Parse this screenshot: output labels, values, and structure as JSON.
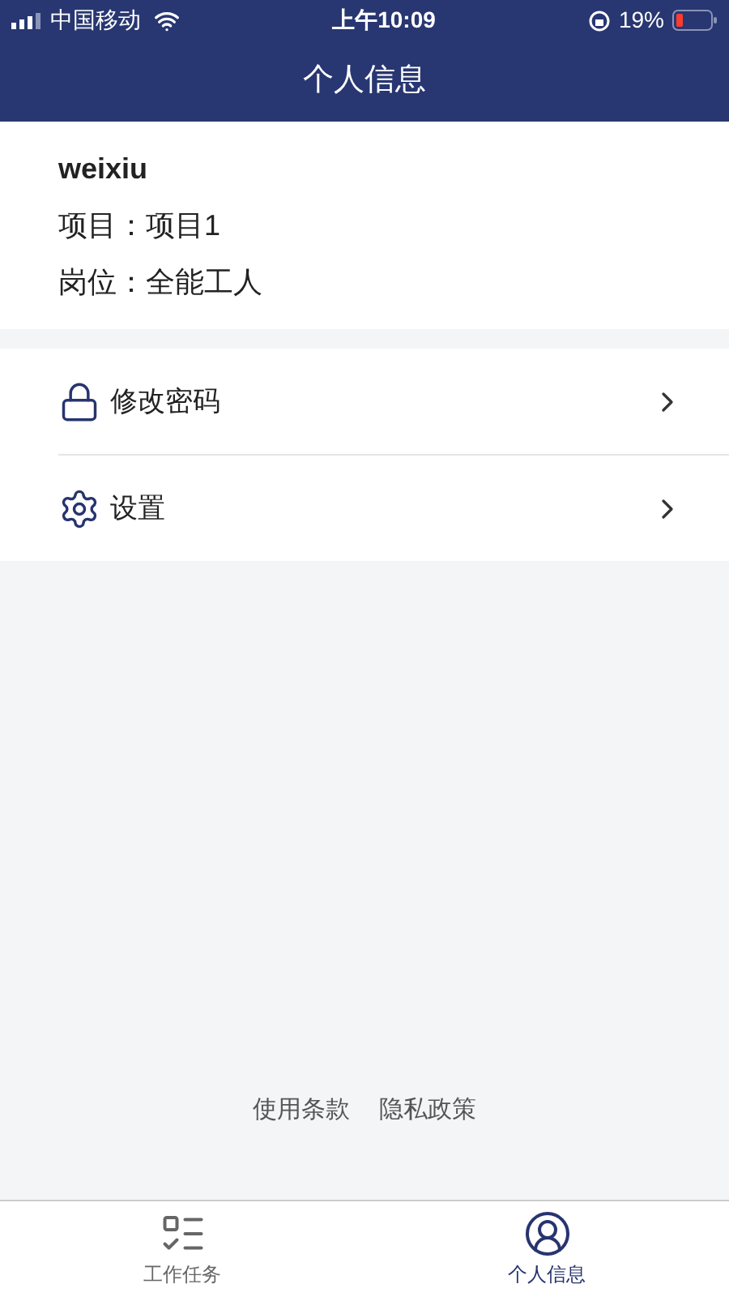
{
  "status_bar": {
    "carrier": "中国移动",
    "time": "上午10:09",
    "battery": "19%"
  },
  "nav_bar": {
    "title": "个人信息"
  },
  "profile": {
    "username": "weixiu",
    "fields": [
      {
        "label": "项目：",
        "value": "项目1"
      },
      {
        "label": "岗位：",
        "value": "全能工人"
      }
    ]
  },
  "menu": [
    {
      "kind": "lock",
      "label": "修改密码"
    },
    {
      "kind": "settings",
      "label": "设置"
    }
  ],
  "footer_links": [
    "使用条款",
    "隐私政策"
  ],
  "tabs": [
    {
      "kind": "tasks",
      "label": "工作任务",
      "selected": false
    },
    {
      "kind": "person",
      "label": "个人信息",
      "selected": true
    }
  ]
}
